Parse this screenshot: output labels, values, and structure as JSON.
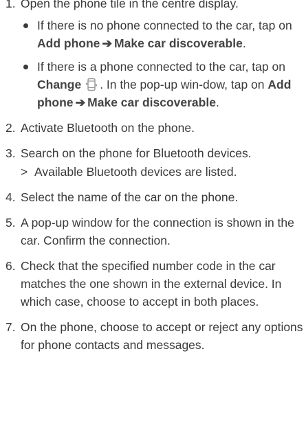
{
  "steps": [
    {
      "num": "1.",
      "text": "Open the phone tile in the centre display.",
      "bullets": [
        {
          "pre": "If there is no phone connected to the car, tap on ",
          "bold1": "Add phone",
          "arrow": "➔",
          "bold2": "Make car discoverable",
          "post": "."
        },
        {
          "pre": "If there is a phone connected to the car, tap on ",
          "bold_change": "Change",
          "icon": "phone-change-icon",
          "mid": ". In the pop-up win-dow, tap on ",
          "bold1": "Add phone",
          "arrow": "➔",
          "bold2": "Make car discoverable",
          "post": "."
        }
      ]
    },
    {
      "num": "2.",
      "text": "Activate Bluetooth on the phone."
    },
    {
      "num": "3.",
      "text": "Search on the phone for Bluetooth devices.",
      "result_marker": ">",
      "result": "Available Bluetooth devices are listed."
    },
    {
      "num": "4.",
      "text": "Select the name of the car on the phone."
    },
    {
      "num": "5.",
      "text": "A pop-up window for the connection is shown in the car. Confirm the connection."
    },
    {
      "num": "6.",
      "text": "Check that the specified number code in the car matches the one shown in the external device. In which case, choose to accept in both places."
    },
    {
      "num": "7.",
      "text": "On the phone, choose to accept or reject any options for phone contacts and messages."
    }
  ]
}
